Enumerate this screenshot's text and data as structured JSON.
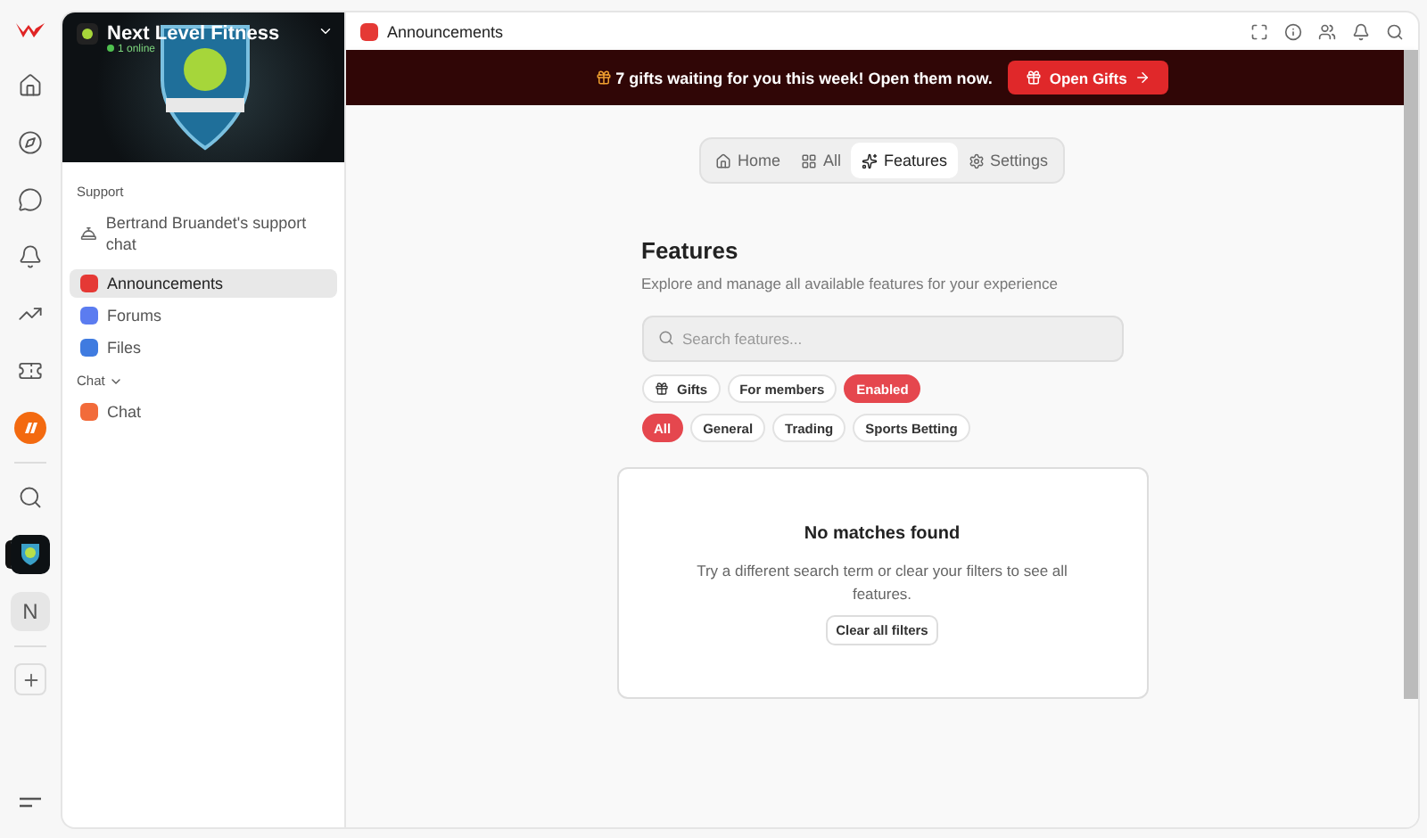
{
  "rail": {
    "items": [
      {
        "kind": "home",
        "selected": false
      },
      {
        "kind": "compass",
        "selected": false
      },
      {
        "kind": "chat",
        "selected": false
      },
      {
        "kind": "bell",
        "selected": false
      },
      {
        "kind": "chart",
        "selected": false
      },
      {
        "kind": "ticket",
        "selected": false
      },
      {
        "kind": "brand",
        "selected": false
      },
      {
        "kind": "search",
        "selected": false
      },
      {
        "kind": "server",
        "selected": true
      },
      {
        "kind": "letter",
        "label": "N",
        "selected": false
      },
      {
        "kind": "add"
      }
    ]
  },
  "sidebar": {
    "server_name": "Next Level Fitness",
    "online": "1 online",
    "sections": [
      {
        "title": "Support",
        "collapsible": false,
        "items": [
          {
            "label": "Bertrand Bruandet's support chat",
            "kind": "support",
            "selected": false
          }
        ]
      },
      {
        "items": [
          {
            "label": "Announcements",
            "kind": "announce",
            "selected": true
          },
          {
            "label": "Forums",
            "kind": "forum",
            "selected": false
          },
          {
            "label": "Files",
            "kind": "files",
            "selected": false
          }
        ]
      },
      {
        "title": "Chat",
        "collapsible": true,
        "items": [
          {
            "label": "Chat",
            "kind": "chat",
            "selected": false
          }
        ]
      }
    ]
  },
  "topbar": {
    "title": "Announcements"
  },
  "banner": {
    "text": "7 gifts waiting for you this week! Open them now.",
    "button": "Open Gifts"
  },
  "tabs": [
    {
      "label": "Home",
      "kind": "home",
      "selected": false
    },
    {
      "label": "All",
      "kind": "grid",
      "selected": false
    },
    {
      "label": "Features",
      "kind": "sparkle",
      "selected": true
    },
    {
      "label": "Settings",
      "kind": "gear",
      "selected": false
    }
  ],
  "features": {
    "title": "Features",
    "subtitle": "Explore and manage all available features for your experience",
    "search": {
      "placeholder": "Search features..."
    },
    "filters": [
      {
        "label": "Gifts",
        "kind": "gift",
        "selected": false
      },
      {
        "label": "For members",
        "kind": "plain",
        "selected": false
      },
      {
        "label": "Enabled",
        "kind": "plain",
        "selected": true
      }
    ],
    "categories": [
      {
        "label": "All",
        "selected": true
      },
      {
        "label": "General",
        "selected": false
      },
      {
        "label": "Trading",
        "selected": false
      },
      {
        "label": "Sports Betting",
        "selected": false
      }
    ],
    "empty": {
      "title": "No matches found",
      "text": "Try a different search term or clear your filters to see all features.",
      "button": "Clear all filters"
    }
  }
}
